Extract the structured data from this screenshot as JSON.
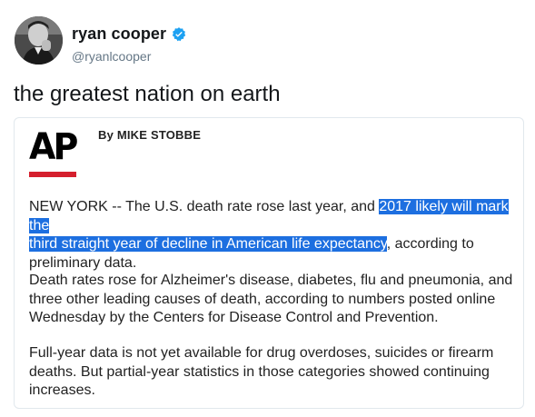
{
  "tweet": {
    "author": {
      "display_name": "ryan cooper",
      "handle": "@ryanlcooper",
      "verified_icon": "verified-badge-icon"
    },
    "text": "the greatest nation on earth"
  },
  "card": {
    "logo_text": "AP",
    "byline": "By MIKE STOBBE",
    "paragraphs": {
      "p1_before": "NEW YORK -- The U.S. death rate rose last year, and ",
      "p1_highlight_a": "2017 likely will mark the",
      "p1_highlight_b": "third straight year of decline in American life expectancy",
      "p1_after_b": ", according to",
      "p1_end": "preliminary data.",
      "p2": "Death rates rose for Alzheimer's disease, diabetes, flu and pneumonia, and three other leading causes of death, according to numbers posted online Wednesday by the Centers for Disease Control and Prevention.",
      "p3": "Full-year data is not yet available for drug overdoses, suicides or firearm deaths. But partial-year statistics in those categories showed continuing increases."
    }
  },
  "colors": {
    "verified_blue": "#1da1f2",
    "highlight": "#1d6fe0",
    "ap_red": "#d51f2d"
  }
}
